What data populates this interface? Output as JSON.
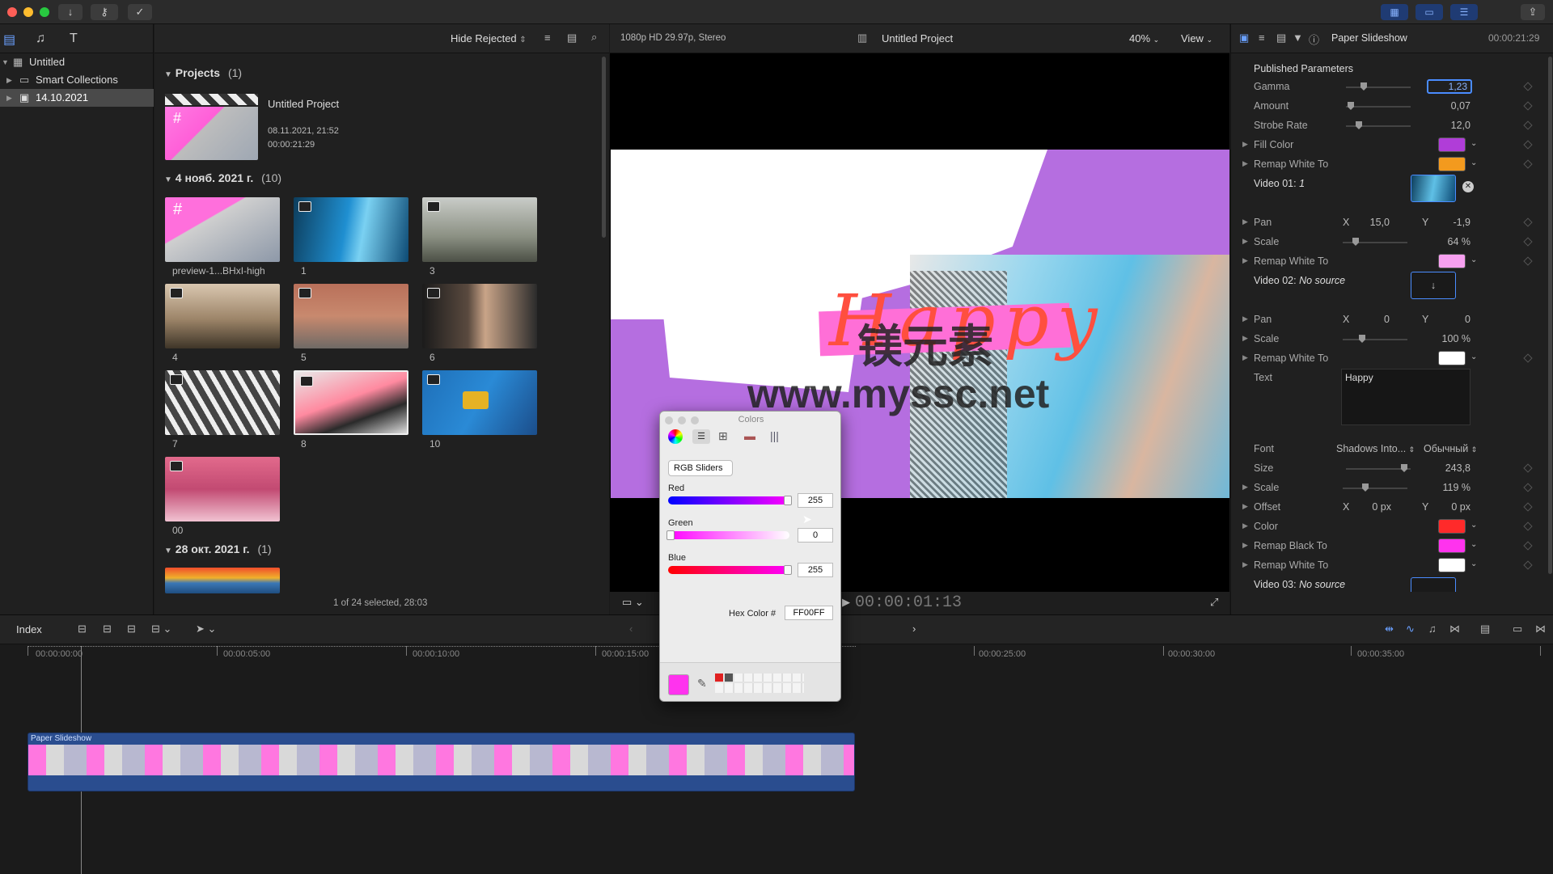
{
  "library": {
    "items": [
      {
        "label": "Untitled"
      },
      {
        "label": "Smart Collections"
      },
      {
        "label": "14.10.2021"
      }
    ]
  },
  "browser": {
    "filter_label": "Hide Rejected",
    "projects_header": "Projects",
    "projects_count": "(1)",
    "project": {
      "name": "Untitled Project",
      "date": "08.11.2021, 21:52",
      "duration": "00:00:21:29"
    },
    "event1_header": "4 нояб. 2021 г.",
    "event1_count": "(10)",
    "clips": [
      "preview-1...BHxI-high",
      "1",
      "3",
      "4",
      "5",
      "6",
      "7",
      "8",
      "10",
      "00"
    ],
    "event2_header": "28 окт. 2021 г.",
    "event2_count": "(1)",
    "status": "1 of 24 selected, 28:03"
  },
  "viewer": {
    "format": "1080p HD 29.97p, Stereo",
    "title": "Untitled Project",
    "zoom": "40%",
    "view_label": "View",
    "timecode": "00:00:01:13",
    "overlay_text": "Happy",
    "watermark_cn": "镁元素",
    "watermark_url": "www.myssc.net"
  },
  "inspector": {
    "title": "Paper Slideshow",
    "duration": "00:00:21:29",
    "section": "Published Parameters",
    "gamma_label": "Gamma",
    "gamma_value": "1,23",
    "amount_label": "Amount",
    "amount_value": "0,07",
    "strobe_label": "Strobe Rate",
    "strobe_value": "12,0",
    "fill_label": "Fill Color",
    "remap_white_label": "Remap White To",
    "video01_label": "Video 01:",
    "video01_value": "1",
    "pan_label": "Pan",
    "x_label": "X",
    "y_label": "Y",
    "pan1_x": "15,0",
    "pan1_y": "-1,9",
    "scale_label": "Scale",
    "scale1_value": "64 %",
    "video02_label": "Video 02:",
    "video02_value": "No source",
    "pan2_x": "0",
    "pan2_y": "0",
    "scale2_value": "100 %",
    "text_label": "Text",
    "text_value": "Happy",
    "font_label": "Font",
    "font_family": "Shadows Into...",
    "font_style": "Обычный",
    "size_label": "Size",
    "size_value": "243,8",
    "scale3_value": "119 %",
    "offset_label": "Offset",
    "offset_x": "0 px",
    "offset_y": "0 px",
    "color_label": "Color",
    "remap_black_label": "Remap Black To",
    "video03_label": "Video 03:",
    "video03_value": "No source"
  },
  "timeline": {
    "index_label": "Index",
    "ruler": [
      "00:00:00:00",
      "00:00:05:00",
      "00:00:10:00",
      "00:00:15:00",
      "00:00:25:00",
      "00:00:30:00",
      "00:00:35:00"
    ],
    "clip_name": "Paper Slideshow"
  },
  "colors_panel": {
    "title": "Colors",
    "mode": "RGB Sliders",
    "red_label": "Red",
    "red_value": "255",
    "green_label": "Green",
    "green_value": "0",
    "blue_label": "Blue",
    "blue_value": "255",
    "hex_label": "Hex Color #",
    "hex_value": "FF00FF"
  },
  "colors": {
    "accent": "#4a8cff",
    "fill_color": "#b03dd8",
    "remap_white1": "#f39a1e",
    "remap_white2": "#f7a0f0",
    "remap_white3": "#ffffff",
    "text_color": "#ff2a2a",
    "remap_black": "#ff33ee",
    "remap_white4": "#ffffff",
    "selected_color": "#ff33ee"
  }
}
